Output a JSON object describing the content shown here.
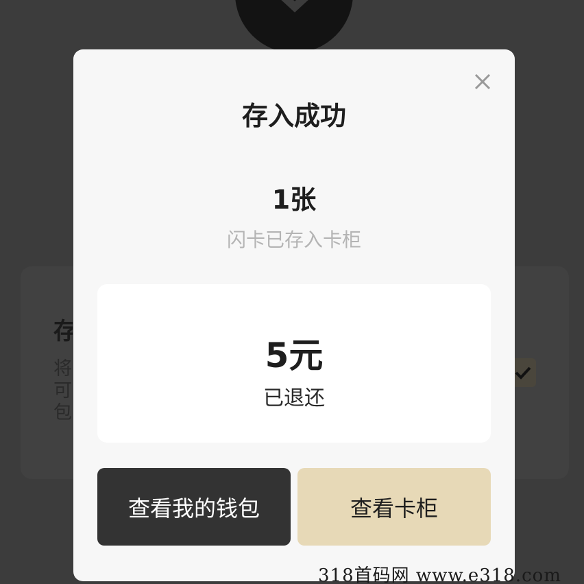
{
  "background": {
    "card_title": "存",
    "card_desc_lines": [
      "将",
      "可",
      "包"
    ]
  },
  "modal": {
    "title": "存入成功",
    "count": "1张",
    "count_desc": "闪卡已存入卡柜",
    "refund_amount": "5元",
    "refund_status": "已退还",
    "wallet_button_label": "查看我的钱包",
    "cabinet_button_label": "查看卡柜"
  },
  "watermark": "318首码网  www.e318.com",
  "colors": {
    "overlay": "#3c3c3c",
    "modal_bg": "#f7f7f7",
    "primary_dark": "#333333",
    "accent_gold": "#e7d9b7"
  },
  "icons": {
    "close": "close-icon",
    "success": "checkmark-icon"
  }
}
